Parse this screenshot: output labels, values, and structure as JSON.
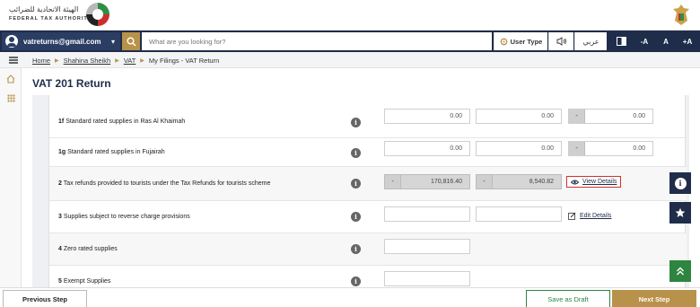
{
  "brand": {
    "name_ar": "الهيئة الاتحادية للضرائب",
    "name_en": "FEDERAL TAX AUTHORITY"
  },
  "nav": {
    "user_email": "vatreturns@gmail.com",
    "search_placeholder": "What are you looking for?",
    "user_type_label": "User Type",
    "arabic_label": "عربي",
    "font_decrease": "-A",
    "font_normal": "A",
    "font_increase": "+A"
  },
  "breadcrumb": {
    "home": "Home",
    "user": "Shahina Sheikh",
    "vat": "VAT",
    "current": "My Filings - VAT Return"
  },
  "page": {
    "title": "VAT 201 Return"
  },
  "rows": [
    {
      "code": "1f",
      "label": "Standard rated supplies in Ras Al Khaimah",
      "amount": "0.00",
      "vat": "0.00",
      "adj_prefix": "-",
      "adjustment": "0.00"
    },
    {
      "code": "1g",
      "label": "Standard rated supplies in Fujairah",
      "amount": "0.00",
      "vat": "0.00",
      "adj_prefix": "-",
      "adjustment": "0.00"
    },
    {
      "code": "2",
      "label": "Tax refunds provided to tourists under the Tax Refunds for tourists scheme",
      "amount_prefix": "-",
      "amount": "170,816.40",
      "vat_prefix": "-",
      "vat": "8,540.82",
      "action": "View Details"
    },
    {
      "code": "3",
      "label": "Supplies subject to reverse charge provisions",
      "amount": "",
      "vat": "",
      "action": "Edit Details"
    },
    {
      "code": "4",
      "label": "Zero rated supplies",
      "amount": ""
    },
    {
      "code": "5",
      "label": "Exempt Supplies",
      "amount": ""
    }
  ],
  "info_glyph": "i",
  "footer": {
    "previous": "Previous Step",
    "draft": "Save as Draft",
    "next": "Next Step"
  },
  "colors": {
    "navy": "#1f2d4a",
    "gold": "#b8924a",
    "green": "#2e8540",
    "highlight_red": "#d0312d"
  }
}
